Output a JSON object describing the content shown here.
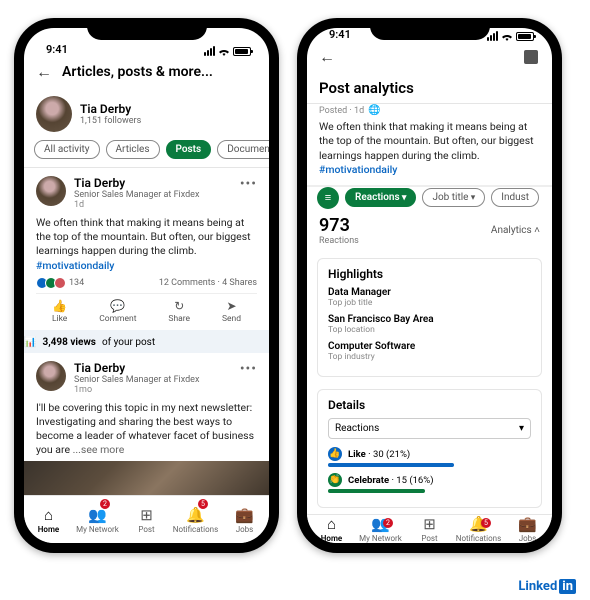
{
  "statusbar": {
    "time": "9:41"
  },
  "left": {
    "header_title": "Articles, posts & more...",
    "profile": {
      "name": "Tia Derby",
      "followers": "1,151 followers"
    },
    "chips": [
      "All activity",
      "Articles",
      "Posts",
      "Documen"
    ],
    "active_chip_index": 2,
    "post1": {
      "name": "Tia Derby",
      "role": "Senior Sales Manager at Fixdex",
      "age": "1d",
      "text": "We often think that making it means being at the top of the mountain. But often, our biggest learnings happen during the climb. ",
      "hashtag": "#motivationdaily",
      "reactions_count": "134",
      "comments": "12 Comments",
      "shares": "4 Shares",
      "views_count": "3,498 views",
      "views_suffix": " of your post",
      "actions": {
        "like": "Like",
        "comment": "Comment",
        "share": "Share",
        "send": "Send"
      }
    },
    "post2": {
      "name": "Tia Derby",
      "role": "Senior Sales Manager at Fixdex",
      "age": "1mo",
      "text": "I'll be covering this topic in my next newsletter: Investigating and sharing the best ways to become a leader of whatever facet of business you are ",
      "see_more": "...see more"
    }
  },
  "right": {
    "title": "Post analytics",
    "posted": "Posted · 1d",
    "body": "We often think that making it means being at the top of the mountain. But often, our biggest learnings happen during the climb. ",
    "hashtag": "#motivationdaily",
    "chips": [
      "Reactions",
      "Job title",
      "Indust"
    ],
    "active_chip_index": 0,
    "metric_value": "973",
    "metric_label": "Reactions",
    "analytics_link": "Analytics",
    "highlights": {
      "title": "Highlights",
      "items": [
        {
          "t": "Data Manager",
          "s": "Top job title"
        },
        {
          "t": "San Francisco Bay Area",
          "s": "Top location"
        },
        {
          "t": "Computer Software",
          "s": "Top industry"
        }
      ]
    },
    "details": {
      "title": "Details",
      "select": "Reactions",
      "rows": [
        {
          "icon": "blue",
          "glyph": "👍",
          "label": "Like",
          "count": "30",
          "pct": "(21%)"
        },
        {
          "icon": "green",
          "glyph": "👏",
          "label": "Celebrate",
          "count": "15",
          "pct": "(16%)"
        }
      ]
    }
  },
  "tabbar": [
    {
      "label": "Home",
      "icon": "⌂",
      "active": true
    },
    {
      "label": "My Network",
      "icon": "👥",
      "badge": "2"
    },
    {
      "label": "Post",
      "icon": "⊞"
    },
    {
      "label": "Notifications",
      "icon": "🔔",
      "badge": "5"
    },
    {
      "label": "Jobs",
      "icon": "💼"
    }
  ],
  "brand": "Linked"
}
